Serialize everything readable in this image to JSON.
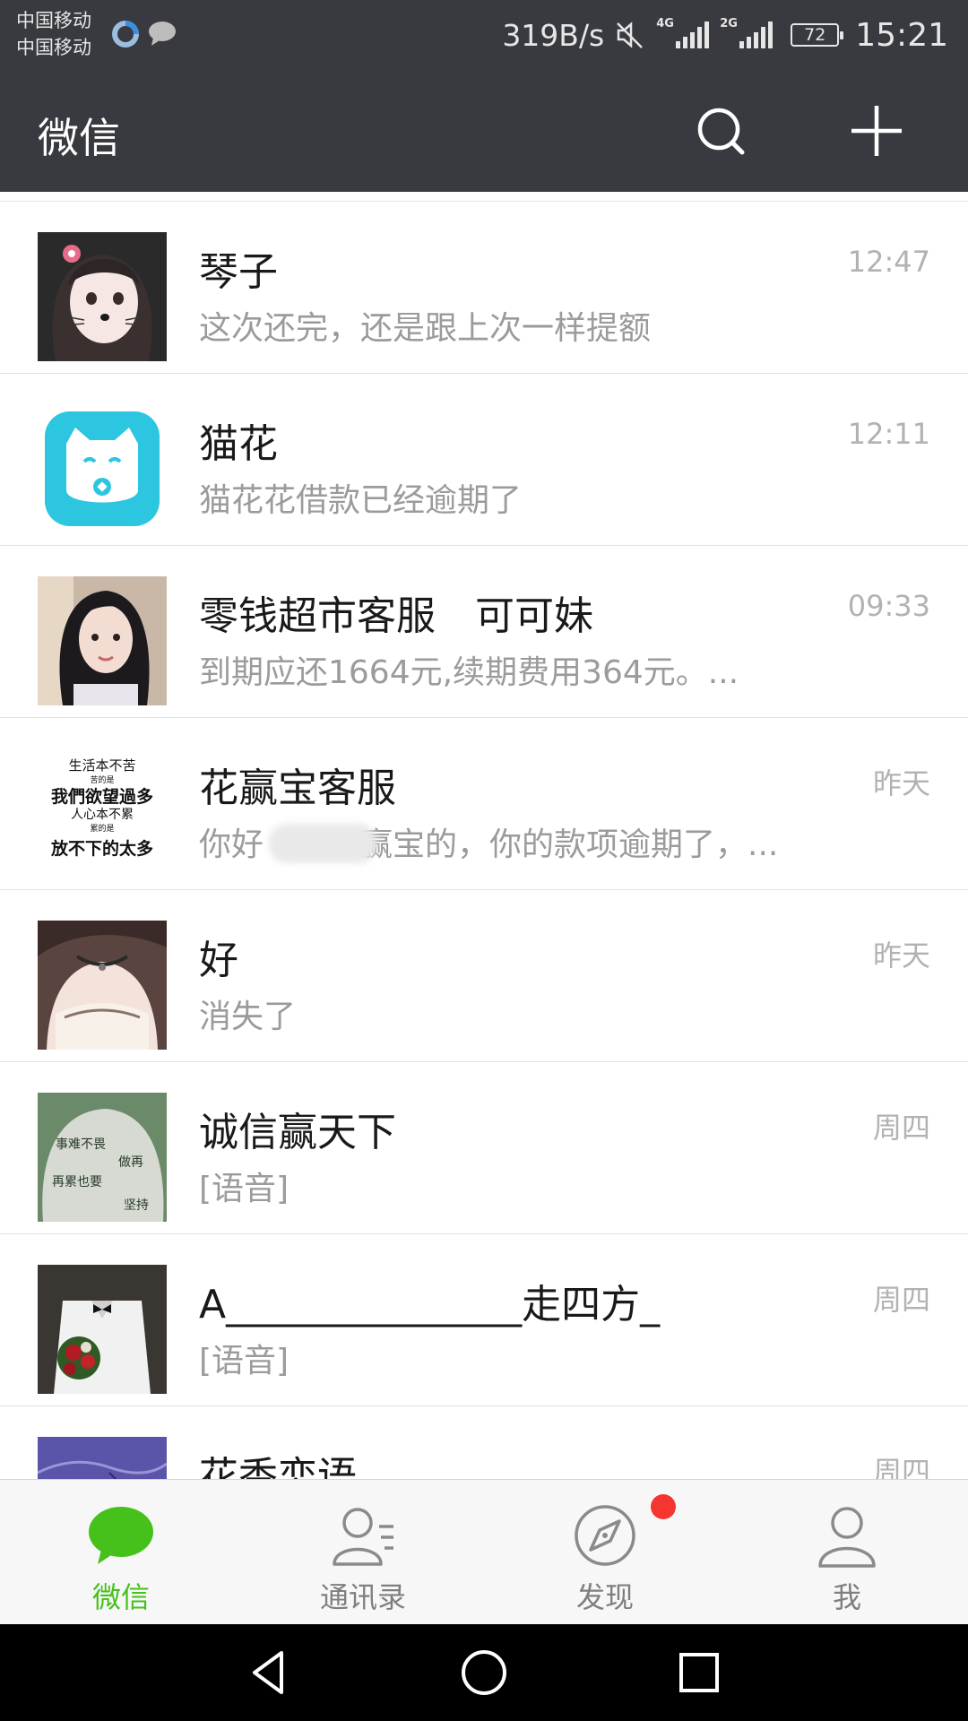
{
  "status_bar": {
    "carrier_1": "中国移动",
    "carrier_2": "中国移动",
    "net_speed": "319B/s",
    "signal_1_tag": "4G",
    "signal_2_tag": "2G",
    "battery": "72",
    "time": "15:21",
    "icons": [
      "qq-icon",
      "message-icon",
      "mute-icon",
      "signal-icon",
      "battery-icon"
    ]
  },
  "header": {
    "title": "微信",
    "search_icon": "search-icon",
    "add_icon": "plus-icon"
  },
  "chats": [
    {
      "name": "琴子",
      "preview": "这次还完，还是跟上次一样提额",
      "time": "12:47"
    },
    {
      "name": "猫花",
      "preview": "猫花花借款已经逾期了",
      "time": "12:11"
    },
    {
      "name": "零钱超市客服　可可妹",
      "preview": "到期应还1664元,续期费用364元。...",
      "time": "09:33"
    },
    {
      "name": "花赢宝客服",
      "preview": "你好　　　赢宝的，你的款项逾期了，...",
      "time": "昨天"
    },
    {
      "name": "好",
      "preview": "消失了",
      "time": "昨天"
    },
    {
      "name": "诚信赢天下",
      "preview": "[语音]",
      "time": "周四"
    },
    {
      "name": "A_______________走四方_",
      "preview": "[语音]",
      "time": "周四"
    },
    {
      "name": "花香恋语",
      "preview": "",
      "time": "周四"
    }
  ],
  "avatar_texts": {
    "quote": [
      "生活本不苦",
      "苦的是",
      "我們欲望過多",
      "人心本不累",
      "累的是",
      "放不下的太多"
    ],
    "stone": [
      "事难不畏",
      "做再",
      "再累也要",
      "坚持"
    ]
  },
  "tabs": [
    {
      "label": "微信",
      "icon": "chat-icon",
      "active": true
    },
    {
      "label": "通讯录",
      "icon": "contacts-icon",
      "active": false
    },
    {
      "label": "发现",
      "icon": "compass-icon",
      "active": false
    },
    {
      "label": "我",
      "icon": "profile-icon",
      "active": false
    }
  ],
  "colors": {
    "header_bg": "#393a3f",
    "accent_green": "#46c01b",
    "badge_red": "#f43530",
    "tab_inactive": "#7f7f7f"
  }
}
